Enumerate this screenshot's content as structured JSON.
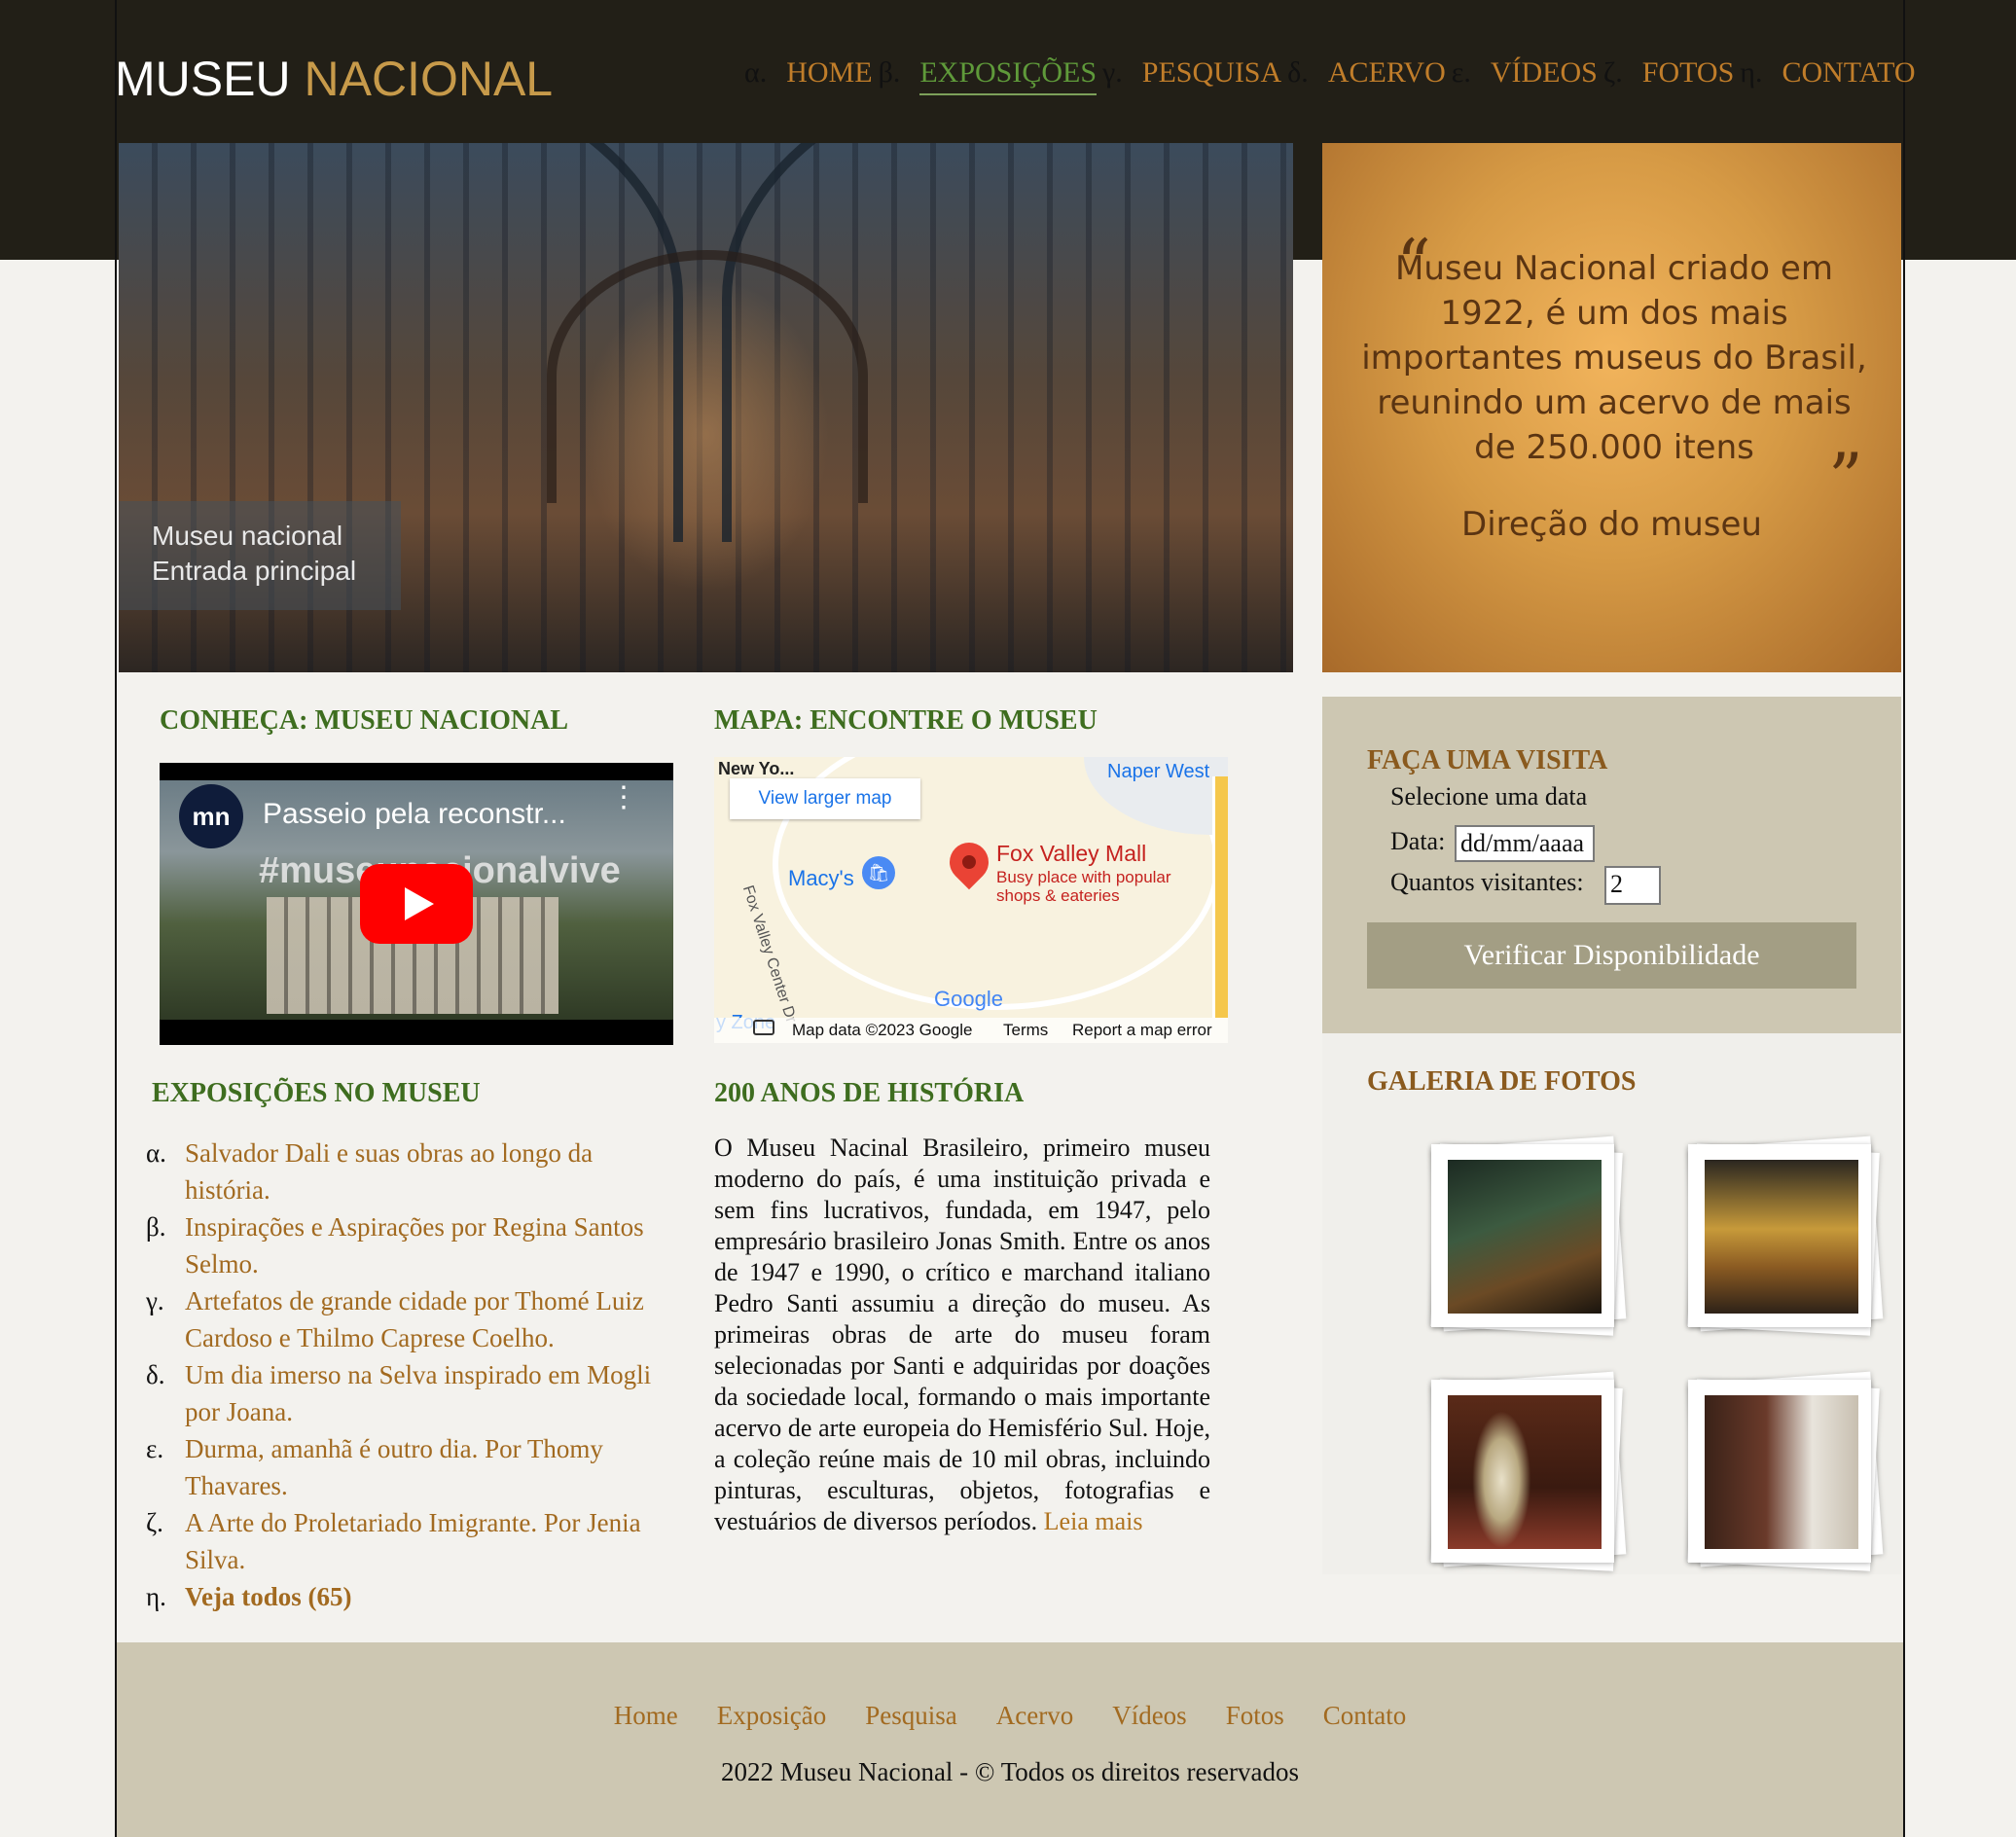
{
  "header": {
    "logo_part1": "MUSEU",
    "logo_part2": "NACIONAL",
    "nav": [
      {
        "num": "α.",
        "label": "HOME"
      },
      {
        "num": "β.",
        "label": "EXPOSIÇÕES"
      },
      {
        "num": "γ.",
        "label": "PESQUISA"
      },
      {
        "num": "δ.",
        "label": "ACERVO"
      },
      {
        "num": "ε.",
        "label": "VÍDEOS"
      },
      {
        "num": "ζ.",
        "label": "FOTOS"
      },
      {
        "num": "η.",
        "label": "CONTATO"
      }
    ],
    "active_nav": "EXPOSIÇÕES"
  },
  "hero": {
    "caption_line1": "Museu nacional",
    "caption_line2": "Entrada principal"
  },
  "quote": {
    "open_mark": "“",
    "close_mark": "”",
    "text": "Museu Nacional criado em 1922, é um dos mais importantes museus do Brasil, reunindo um acervo de mais de 250.000 itens",
    "author": "Direção do museu"
  },
  "conheca": {
    "heading": "CONHEÇA: MUSEU NACIONAL",
    "video": {
      "channel_logo": "mn",
      "title": "Passeio pela reconstr...",
      "hashtag": "#museunacionalvive"
    }
  },
  "mapa": {
    "heading": "MAPA: ENCONTRE O MUSEU",
    "view_larger": "View larger map",
    "place_name": "Fox Valley Mall",
    "place_desc_line1": "Busy place with popular",
    "place_desc_line2": "shops & eateries",
    "store_label": "Macy's",
    "street_label": "Fox Valley Center Dr",
    "top_left_label": "New Yo...",
    "top_right_label": "Naper West",
    "bottom_left_label": "y Zone",
    "google_logo": "Google",
    "attribution": {
      "data": "Map data ©2023 Google",
      "terms": "Terms",
      "report": "Report a map error"
    }
  },
  "exposicoes": {
    "heading": "EXPOSIÇÕES NO MUSEU",
    "items": [
      {
        "mark": "α.",
        "text": "Salvador Dali e suas obras ao longo da história."
      },
      {
        "mark": "β.",
        "text": "Inspirações e Aspirações por Regina Santos Selmo."
      },
      {
        "mark": "γ.",
        "text": "Artefatos de grande cidade por Thomé Luiz Cardoso e Thilmo Caprese Coelho."
      },
      {
        "mark": "δ.",
        "text": "Um dia imerso na Selva inspirado em Mogli por Joana."
      },
      {
        "mark": "ε.",
        "text": "Durma, amanhã é outro dia. Por Thomy Thavares."
      },
      {
        "mark": "ζ.",
        "text": "A Arte do Proletariado Imigrante. Por Jenia Silva."
      },
      {
        "mark": "η.",
        "text": "Veja todos (65)"
      }
    ]
  },
  "historia": {
    "heading": "200 ANOS DE HISTÓRIA",
    "text": "O Museu Nacinal Brasileiro, primeiro museu moderno do país, é uma instituição privada e sem fins lucrativos, fundada, em 1947, pelo empresário brasileiro Jonas Smith. Entre os anos de 1947 e 1990, o crítico e marchand italiano Pedro Santi assumiu a direção do museu. As primeiras obras de arte do museu foram selecionadas por Santi e adquiridas por doações da sociedade local, formando o mais importante acervo de arte europeia do Hemisfério Sul. Hoje, a coleção reúne mais de 10 mil obras, incluindo pinturas, esculturas, objetos, fotografias e vestuários de diversos períodos.",
    "read_more": "Leia mais"
  },
  "visita": {
    "heading": "FAÇA UMA VISITA",
    "select_date": "Selecione uma data",
    "date_label": "Data:",
    "date_placeholder": "dd/mm/aaaa",
    "visitors_label": "Quantos visitantes:",
    "visitors_value": "2",
    "button": "Verificar Disponibilidade"
  },
  "galeria": {
    "heading": "GALERIA DE FOTOS"
  },
  "footer": {
    "nav": [
      "Home",
      "Exposição",
      "Pesquisa",
      "Acervo",
      "Vídeos",
      "Fotos",
      "Contato"
    ],
    "copyright": "2022 Museu Nacional - © Todos os direitos reservados"
  },
  "colors": {
    "header_bg": "#221f17",
    "nav_link": "#c07d2a",
    "nav_active": "#5f9a3a",
    "section_green": "#3e6d1f",
    "section_brown": "#8a5a1e",
    "panel_bg": "#cdc7b2",
    "button_bg": "#a39e84"
  }
}
